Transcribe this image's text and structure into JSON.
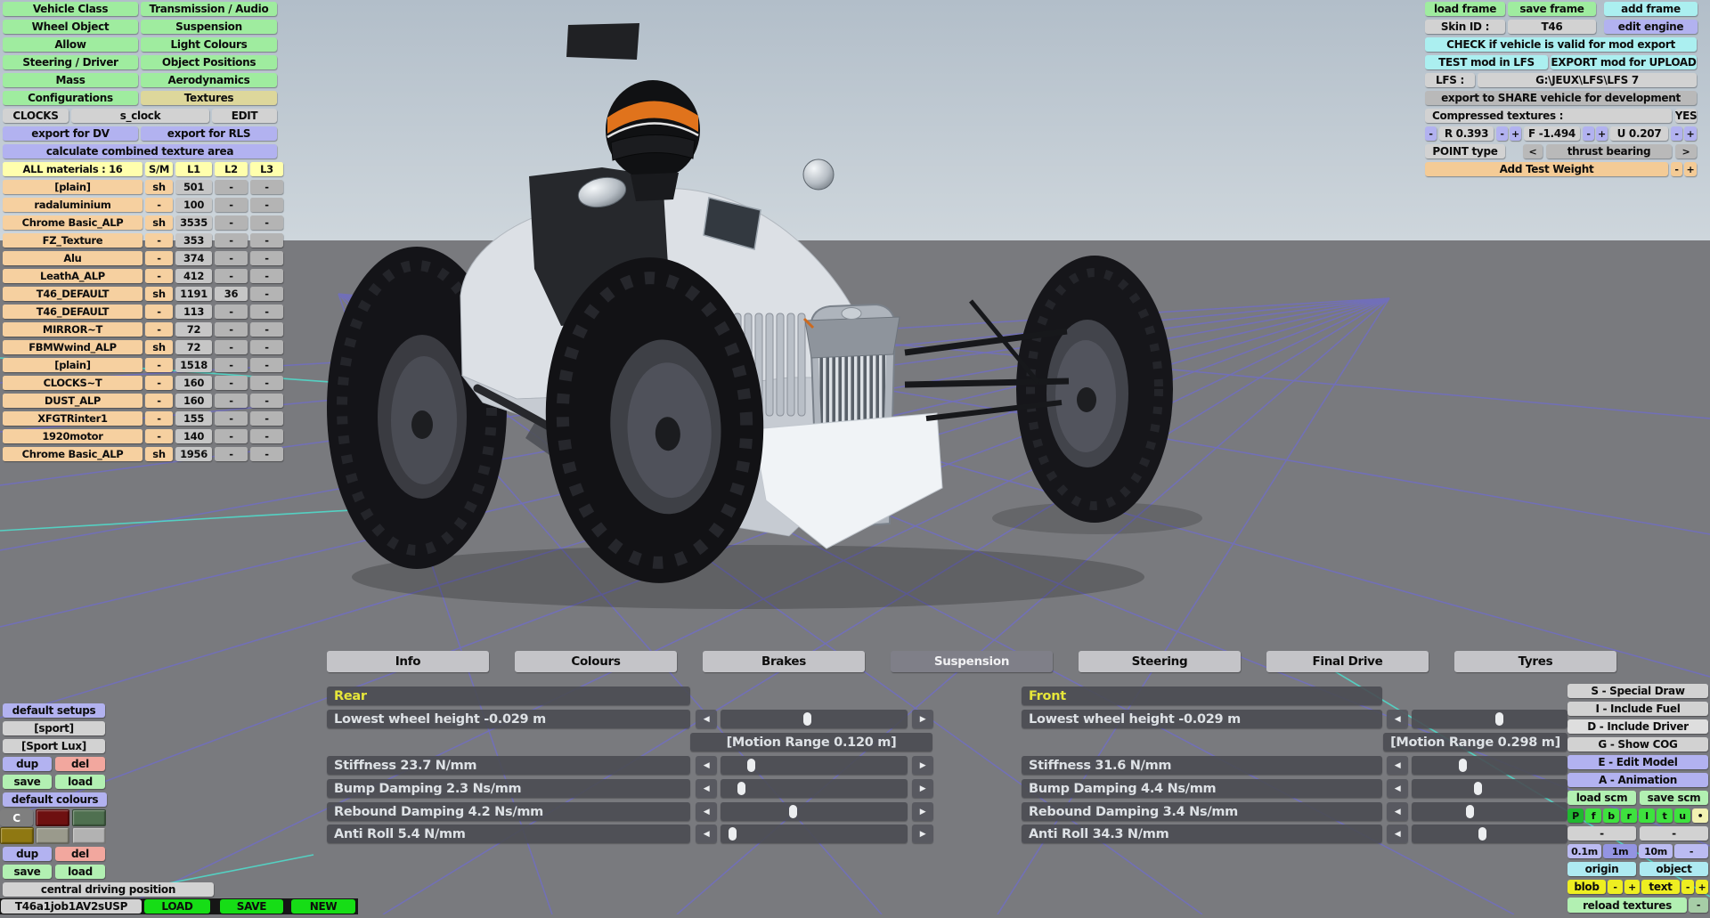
{
  "menu": {
    "left_col": [
      "Vehicle Class",
      "Wheel Object",
      "Allow",
      "Steering / Driver",
      "Mass",
      "Configurations"
    ],
    "right_col": [
      "Transmission / Audio",
      "Suspension",
      "Light Colours",
      "Object Positions",
      "Aerodynamics",
      "Textures"
    ],
    "active_item": "Textures",
    "row2": [
      "CLOCKS",
      "s_clock",
      "EDIT"
    ],
    "export_dv": "export for DV",
    "export_rls": "export for RLS",
    "calc": "calculate combined texture area"
  },
  "materials": {
    "header": [
      "ALL materials : 16",
      "S/M",
      "L1",
      "L2",
      "L3"
    ],
    "rows": [
      [
        "[plain]",
        "sh",
        "501",
        "-",
        "-"
      ],
      [
        "radaluminium",
        "-",
        "100",
        "-",
        "-"
      ],
      [
        "Chrome Basic_ALP",
        "sh",
        "3535",
        "-",
        "-"
      ],
      [
        "FZ_Texture",
        "-",
        "353",
        "-",
        "-"
      ],
      [
        "Alu",
        "-",
        "374",
        "-",
        "-"
      ],
      [
        "LeathA_ALP",
        "-",
        "412",
        "-",
        "-"
      ],
      [
        "T46_DEFAULT",
        "sh",
        "1191",
        "36",
        "-"
      ],
      [
        "T46_DEFAULT",
        "-",
        "113",
        "-",
        "-"
      ],
      [
        "MIRROR~T",
        "-",
        "72",
        "-",
        "-"
      ],
      [
        "FBMWwind_ALP",
        "sh",
        "72",
        "-",
        "-"
      ],
      [
        "[plain]",
        "-",
        "1518",
        "-",
        "-"
      ],
      [
        "CLOCKS~T",
        "-",
        "160",
        "-",
        "-"
      ],
      [
        "DUST_ALP",
        "-",
        "160",
        "-",
        "-"
      ],
      [
        "XFGTRinter1",
        "-",
        "155",
        "-",
        "-"
      ],
      [
        "1920motor",
        "-",
        "140",
        "-",
        "-"
      ],
      [
        "Chrome Basic_ALP",
        "sh",
        "1956",
        "-",
        "-"
      ]
    ]
  },
  "top_right": {
    "load_frame": "load frame",
    "save_frame": "save frame",
    "add_frame": "add frame",
    "skin_label": "Skin ID :",
    "skin_value": "T46",
    "edit_engine": "edit engine",
    "check_button": "CHECK if vehicle is valid for mod export",
    "test_button": "TEST mod in LFS",
    "export_button": "EXPORT mod for UPLOAD",
    "lfs_label": "LFS :",
    "lfs_path": "G:\\JEUX\\LFS\\LFS 7",
    "share_button": "export to SHARE vehicle for development",
    "compressed_label": "Compressed textures :",
    "compressed_value": "YES",
    "r_value": "R 0.393",
    "f_value": "F -1.494",
    "u_value": "U 0.207",
    "point_label": "POINT type",
    "point_prev": "<",
    "point_value": "thrust bearing",
    "point_next": ">",
    "add_test_weight": "Add Test Weight",
    "minus": "-",
    "plus": "+"
  },
  "tabs": [
    "Info",
    "Colours",
    "Brakes",
    "Suspension",
    "Steering",
    "Final Drive",
    "Tyres"
  ],
  "active_tab": "Suspension",
  "suspension": {
    "rear": {
      "title": "Rear",
      "motion_range": "[Motion Range 0.120 m]",
      "rows": [
        {
          "label": "Lowest wheel height -0.029 m",
          "pos": 46
        },
        {
          "label": "Stiffness 23.7 N/mm",
          "pos": 14
        },
        {
          "label": "Bump Damping 2.3 Ns/mm",
          "pos": 8
        },
        {
          "label": "Rebound Damping 4.2 Ns/mm",
          "pos": 38
        },
        {
          "label": "Anti Roll 5.4 N/mm",
          "pos": 3
        }
      ]
    },
    "front": {
      "title": "Front",
      "motion_range": "[Motion Range 0.298 m]",
      "rows": [
        {
          "label": "Lowest wheel height -0.029 m",
          "pos": 57
        },
        {
          "label": "Stiffness 31.6 N/mm",
          "pos": 31
        },
        {
          "label": "Bump Damping 4.4 Ns/mm",
          "pos": 42
        },
        {
          "label": "Rebound Damping 3.4 Ns/mm",
          "pos": 36
        },
        {
          "label": "Anti Roll 34.3 N/mm",
          "pos": 45
        }
      ]
    }
  },
  "setups": {
    "default_setups": "default setups",
    "items": [
      "[sport]",
      "[Sport Lux]"
    ],
    "dup": "dup",
    "del": "del",
    "save": "save",
    "load": "load",
    "default_colours": "default colours",
    "c_label": "C",
    "swatches": [
      "#6e1010",
      "#4f7050",
      "#8f7812",
      "#9a9a8c",
      "#b2b2b2"
    ],
    "central": "central driving position",
    "setup_name": "T46a1job1AV2sUSP",
    "load_big": "LOAD",
    "save_big": "SAVE",
    "new_big": "NEW"
  },
  "right_panel": {
    "special_draw": "S - Special Draw",
    "include_fuel": "I - Include Fuel",
    "include_driver": "D - Include Driver",
    "show_cog": "G - Show COG",
    "edit_model": "E - Edit Model",
    "animation": "A - Animation",
    "load_scm": "load scm",
    "save_scm": "save scm",
    "view_keys": [
      "P",
      "f",
      "b",
      "r",
      "l",
      "t",
      "u"
    ],
    "dot": "•",
    "dash": "-",
    "grid_sizes": [
      "0.1m",
      "1m",
      "10m",
      "-"
    ],
    "grid_active": "1m",
    "origin": "origin",
    "object": "object",
    "blob": "blob",
    "text": "text",
    "minus": "-",
    "plus": "+",
    "reload_textures": "reload textures"
  },
  "palette": {
    "menu_green": "#9fec9f",
    "selected_tan": "#ddd79b",
    "lavender": "#b2b2f0",
    "cyan": "#abeff0",
    "peach": "#f4cb96",
    "header_yellow": "#ffffad",
    "bright_green": "#16dd16",
    "key_green": "#3ee23e",
    "yellow": "#eeee21",
    "salmon": "#f2a79e",
    "light_green": "#b2f0b2",
    "panel_dark": "#4a4b52",
    "section_title_yellow": "#e6e63a",
    "grid_blue": "#6b66f2",
    "grid_cyan": "#4ee0cf"
  }
}
